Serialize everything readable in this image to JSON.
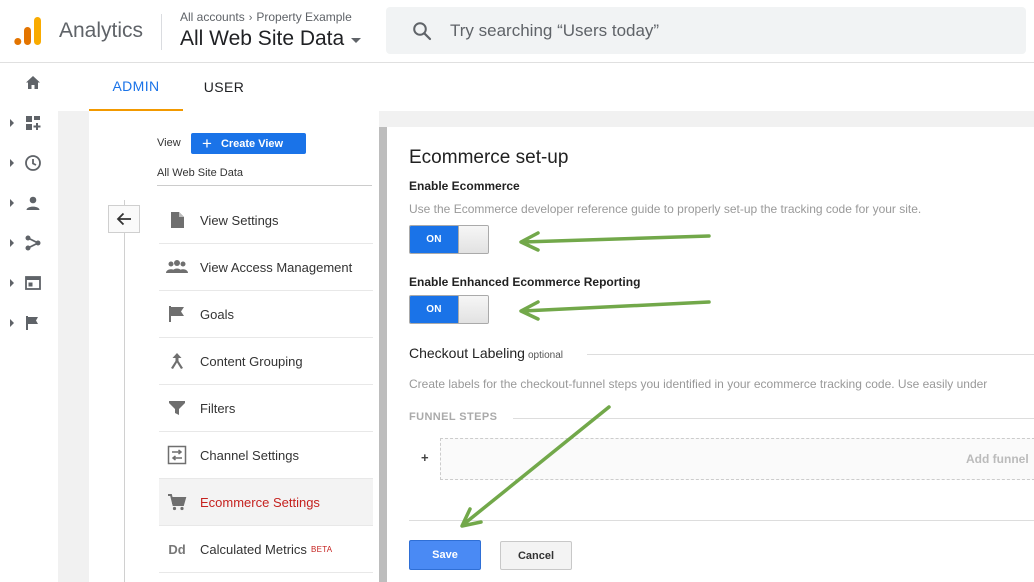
{
  "header": {
    "brand": "Analytics",
    "breadcrumb_accounts": "All accounts",
    "breadcrumb_chevron": "›",
    "breadcrumb_property": "Property Example",
    "property_view": "All Web Site Data",
    "search_placeholder": "Try searching “Users today”"
  },
  "tabs": [
    {
      "label": "ADMIN",
      "active": true
    },
    {
      "label": "USER",
      "active": false
    }
  ],
  "view_panel": {
    "view_label": "View",
    "create_view_label": "Create View",
    "create_view_plus": "+",
    "view_name": "All Web Site Data",
    "items": [
      {
        "label": "View Settings",
        "icon": "document-icon"
      },
      {
        "label": "View Access Management",
        "icon": "people-icon"
      },
      {
        "label": "Goals",
        "icon": "flag-icon"
      },
      {
        "label": "Content Grouping",
        "icon": "merge-icon"
      },
      {
        "label": "Filters",
        "icon": "filter-icon"
      },
      {
        "label": "Channel Settings",
        "icon": "channel-icon"
      },
      {
        "label": "Ecommerce Settings",
        "icon": "cart-icon",
        "active": true
      },
      {
        "label": "Calculated Metrics",
        "icon": "dd-icon",
        "badge": "BETA",
        "glyph": "Dd"
      }
    ]
  },
  "ecommerce": {
    "title": "Ecommerce set-up",
    "enable_title": "Enable Ecommerce",
    "enable_desc": "Use the Ecommerce developer reference guide to properly set-up the tracking code for your site.",
    "enable_toggle": "ON",
    "enhanced_title": "Enable Enhanced Ecommerce Reporting",
    "enhanced_toggle": "ON",
    "checkout_title": "Checkout Labeling",
    "checkout_optional": "optional",
    "checkout_desc": "Create labels for the checkout-funnel steps you identified in your ecommerce tracking code. Use easily under",
    "funnel_heading": "FUNNEL STEPS",
    "funnel_plus": "+",
    "add_funnel": "Add funnel",
    "save_label": "Save",
    "cancel_label": "Cancel"
  },
  "colors": {
    "accent_blue": "#1a73e8",
    "tab_underline": "#f29900",
    "active_red": "#c5221f",
    "arrow_green": "#72a84a",
    "logo_orange": "#f9ab00",
    "logo_dark_orange": "#e37400"
  }
}
